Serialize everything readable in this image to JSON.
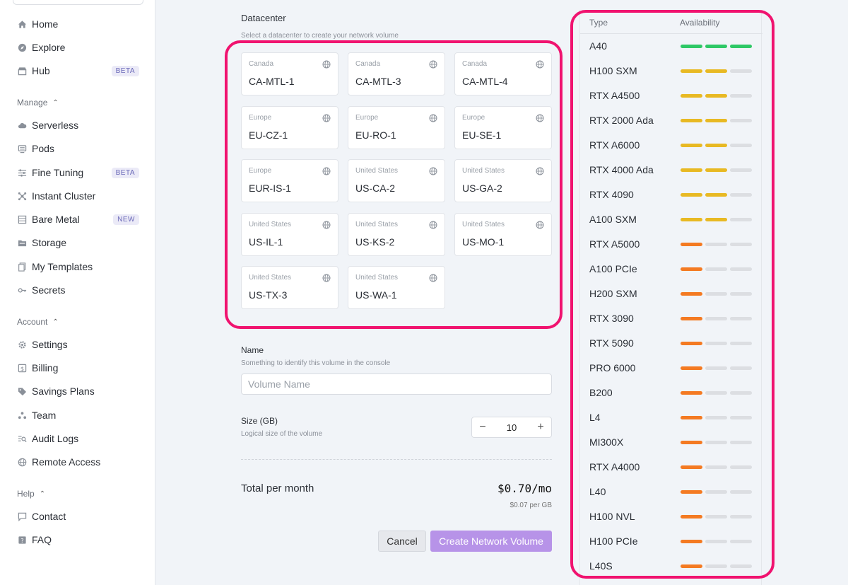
{
  "sidebar": {
    "items": [
      {
        "label": "Home",
        "icon": "home-icon"
      },
      {
        "label": "Explore",
        "icon": "compass-icon"
      },
      {
        "label": "Hub",
        "icon": "store-icon",
        "badge": "BETA"
      }
    ],
    "manage": {
      "title": "Manage",
      "items": [
        {
          "label": "Serverless",
          "icon": "cloud-icon"
        },
        {
          "label": "Pods",
          "icon": "server-icon"
        },
        {
          "label": "Fine Tuning",
          "icon": "sliders-icon",
          "badge": "BETA"
        },
        {
          "label": "Instant Cluster",
          "icon": "cluster-icon"
        },
        {
          "label": "Bare Metal",
          "icon": "rack-icon",
          "badge": "NEW"
        },
        {
          "label": "Storage",
          "icon": "folder-icon"
        },
        {
          "label": "My Templates",
          "icon": "template-icon"
        },
        {
          "label": "Secrets",
          "icon": "key-icon"
        }
      ]
    },
    "account": {
      "title": "Account",
      "items": [
        {
          "label": "Settings",
          "icon": "gear-icon"
        },
        {
          "label": "Billing",
          "icon": "dollar-icon"
        },
        {
          "label": "Savings Plans",
          "icon": "tag-icon"
        },
        {
          "label": "Team",
          "icon": "team-icon"
        },
        {
          "label": "Audit Logs",
          "icon": "audit-icon"
        },
        {
          "label": "Remote Access",
          "icon": "remote-icon"
        }
      ]
    },
    "help": {
      "title": "Help",
      "items": [
        {
          "label": "Contact",
          "icon": "chat-icon"
        },
        {
          "label": "FAQ",
          "icon": "question-icon"
        }
      ]
    }
  },
  "datacenter": {
    "title": "Datacenter",
    "subtitle": "Select a datacenter to create your network volume",
    "options": [
      {
        "region": "Canada",
        "code": "CA-MTL-1"
      },
      {
        "region": "Canada",
        "code": "CA-MTL-3"
      },
      {
        "region": "Canada",
        "code": "CA-MTL-4"
      },
      {
        "region": "Europe",
        "code": "EU-CZ-1"
      },
      {
        "region": "Europe",
        "code": "EU-RO-1"
      },
      {
        "region": "Europe",
        "code": "EU-SE-1"
      },
      {
        "region": "Europe",
        "code": "EUR-IS-1"
      },
      {
        "region": "United States",
        "code": "US-CA-2"
      },
      {
        "region": "United States",
        "code": "US-GA-2"
      },
      {
        "region": "United States",
        "code": "US-IL-1"
      },
      {
        "region": "United States",
        "code": "US-KS-2"
      },
      {
        "region": "United States",
        "code": "US-MO-1"
      },
      {
        "region": "United States",
        "code": "US-TX-3"
      },
      {
        "region": "United States",
        "code": "US-WA-1"
      }
    ]
  },
  "name_field": {
    "label": "Name",
    "help": "Something to identify this volume in the console",
    "placeholder": "Volume Name",
    "value": ""
  },
  "size_field": {
    "label": "Size (GB)",
    "help": "Logical size of the volume",
    "value": "10",
    "minus": "−",
    "plus": "+"
  },
  "total": {
    "label": "Total per month",
    "value": "$0.70/mo",
    "per_gb": "$0.07 per GB"
  },
  "actions": {
    "cancel": "Cancel",
    "create": "Create Network Volume"
  },
  "availability": {
    "col_type": "Type",
    "col_availability": "Availability",
    "colors": {
      "high": "#2ec866",
      "medium": "#e8b923",
      "low": "#f47a22",
      "empty": "#dcdee2"
    },
    "gpus": [
      {
        "name": "A40",
        "level": 3
      },
      {
        "name": "H100 SXM",
        "level": 2
      },
      {
        "name": "RTX A4500",
        "level": 2
      },
      {
        "name": "RTX 2000 Ada",
        "level": 2
      },
      {
        "name": "RTX A6000",
        "level": 2
      },
      {
        "name": "RTX 4000 Ada",
        "level": 2
      },
      {
        "name": "RTX 4090",
        "level": 2
      },
      {
        "name": "A100 SXM",
        "level": 2
      },
      {
        "name": "RTX A5000",
        "level": 1
      },
      {
        "name": "A100 PCIe",
        "level": 1
      },
      {
        "name": "H200 SXM",
        "level": 1
      },
      {
        "name": "RTX 3090",
        "level": 1
      },
      {
        "name": "RTX 5090",
        "level": 1
      },
      {
        "name": "PRO 6000",
        "level": 1
      },
      {
        "name": "B200",
        "level": 1
      },
      {
        "name": "L4",
        "level": 1
      },
      {
        "name": "MI300X",
        "level": 1
      },
      {
        "name": "RTX A4000",
        "level": 1
      },
      {
        "name": "L40",
        "level": 1
      },
      {
        "name": "H100 NVL",
        "level": 1
      },
      {
        "name": "H100 PCIe",
        "level": 1
      },
      {
        "name": "L40S",
        "level": 1
      }
    ]
  }
}
